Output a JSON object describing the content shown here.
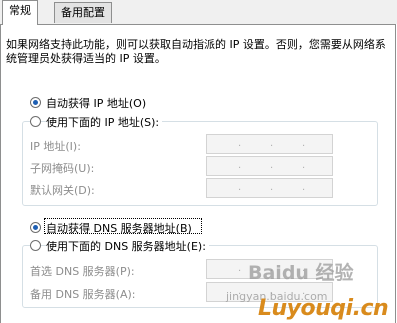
{
  "tabs": [
    {
      "label": "常规",
      "active": true
    },
    {
      "label": "备用配置",
      "active": false
    }
  ],
  "description": "如果网络支持此功能，则可以获取自动指派的 IP 设置。否则，您需要从网络系统管理员处获得适当的 IP 设置。",
  "ip": {
    "auto_option": "自动获得 IP 地址(O)",
    "manual_option": "使用下面的 IP 地址(S):",
    "selected": "auto",
    "fields": [
      {
        "label": "IP 地址(I):",
        "value": ""
      },
      {
        "label": "子网掩码(U):",
        "value": ""
      },
      {
        "label": "默认网关(D):",
        "value": ""
      }
    ]
  },
  "dns": {
    "auto_option": "自动获得 DNS 服务器地址(B)",
    "manual_option": "使用下面的 DNS 服务器地址(E):",
    "selected": "auto",
    "fields": [
      {
        "label": "首选 DNS 服务器(P):",
        "value": ""
      },
      {
        "label": "备用 DNS 服务器(A):",
        "value": ""
      }
    ]
  },
  "watermark": {
    "brand": "Baidu 经验",
    "url_prefix": "jingyan.baidu.com",
    "site": "Luyouqi.cn",
    "colors": {
      "site_main": "#d98b1d",
      "site_accent": "#c7282c",
      "brand": "#9a9a9a"
    }
  },
  "colors": {
    "radio_dot": "#1e5fb3",
    "group_border": "#d5dfe5",
    "disabled_text": "#8d8d8d"
  }
}
